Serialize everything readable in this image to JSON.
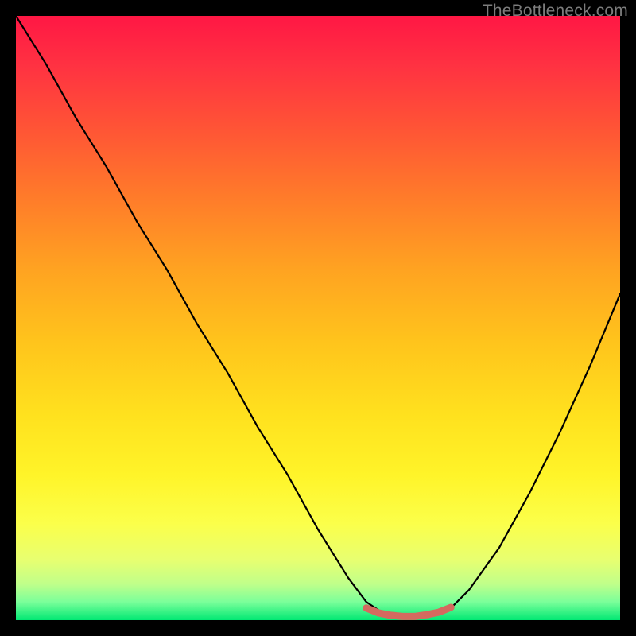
{
  "watermark": "TheBottleneck.com",
  "chart_data": {
    "type": "line",
    "title": "",
    "xlabel": "",
    "ylabel": "",
    "xlim": [
      0,
      100
    ],
    "ylim": [
      0,
      100
    ],
    "grid": false,
    "legend": false,
    "series": [
      {
        "name": "bottleneck-curve",
        "color": "#000000",
        "x": [
          0,
          5,
          10,
          15,
          20,
          25,
          30,
          35,
          40,
          45,
          50,
          55,
          58,
          61,
          63,
          66,
          69,
          72,
          75,
          80,
          85,
          90,
          95,
          100
        ],
        "y": [
          100,
          92,
          83,
          75,
          66,
          58,
          49,
          41,
          32,
          24,
          15,
          7,
          3,
          1,
          0.5,
          0.5,
          1,
          2,
          5,
          12,
          21,
          31,
          42,
          54
        ]
      },
      {
        "name": "bottleneck-valley-highlight",
        "color": "#d46a5f",
        "x": [
          58,
          60,
          62,
          64,
          66,
          68,
          70,
          72
        ],
        "y": [
          2.0,
          1.2,
          0.8,
          0.6,
          0.6,
          0.9,
          1.3,
          2.1
        ]
      }
    ],
    "gradient_bands": [
      {
        "pos": 0.0,
        "color": "#ff1744"
      },
      {
        "pos": 0.3,
        "color": "#ff7b2a"
      },
      {
        "pos": 0.6,
        "color": "#ffe11e"
      },
      {
        "pos": 0.85,
        "color": "#e8ff70"
      },
      {
        "pos": 1.0,
        "color": "#00e873"
      }
    ]
  }
}
